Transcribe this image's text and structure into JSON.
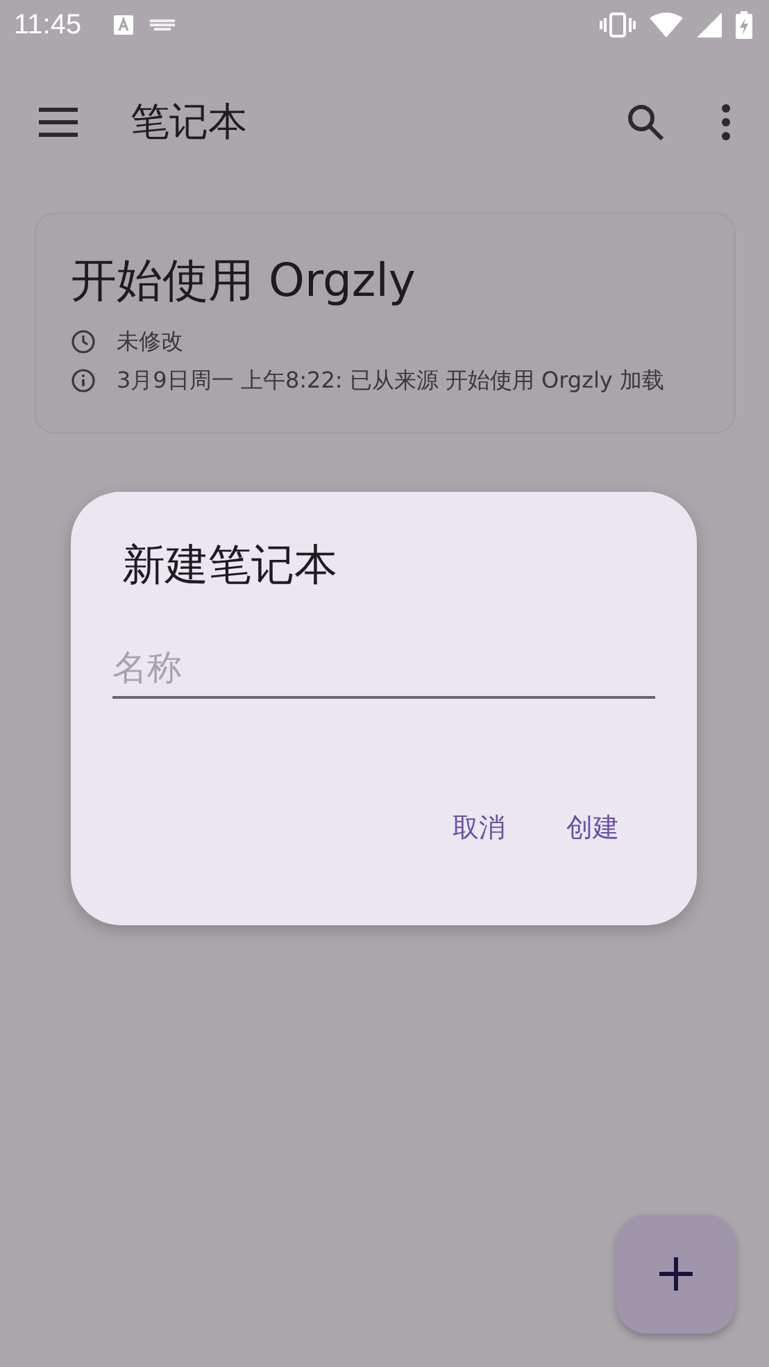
{
  "status_bar": {
    "time": "11:45"
  },
  "app_bar": {
    "title": "笔记本"
  },
  "notebooks": [
    {
      "title": "开始使用 Orgzly",
      "modified": "未修改",
      "info": "3月9日周一 上午8:22: 已从来源 开始使用 Orgzly 加载"
    }
  ],
  "dialog": {
    "title": "新建笔记本",
    "name_field": {
      "placeholder": "名称"
    },
    "buttons": [
      "取消",
      "创建"
    ]
  }
}
